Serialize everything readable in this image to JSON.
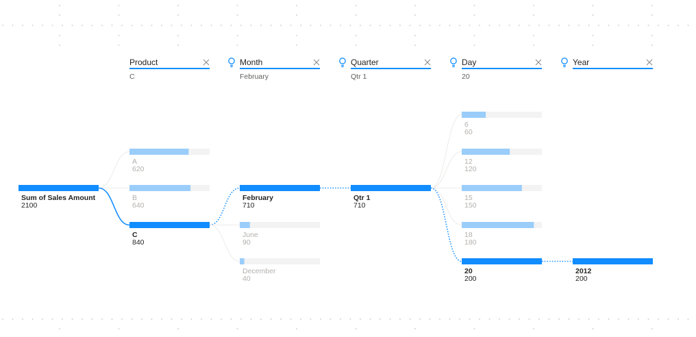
{
  "colors": {
    "accent": "#118DFF",
    "bar_light": "#9ACDFA",
    "bar_track": "#F3F3F3",
    "text_dark": "#252423",
    "text_muted": "#605E5C",
    "text_faded": "#B3B0AD",
    "connector_faded": "#EDEBE9",
    "close_icon": "#8A8886",
    "grid_dot": "#C8C6C4"
  },
  "headers": [
    {
      "field": "Product",
      "selected": "C",
      "icon": null,
      "close_icon": "close-icon"
    },
    {
      "field": "Month",
      "selected": "February",
      "icon": "lightbulb-icon",
      "close_icon": "close-icon"
    },
    {
      "field": "Quarter",
      "selected": "Qtr 1",
      "icon": "lightbulb-icon",
      "close_icon": "close-icon"
    },
    {
      "field": "Day",
      "selected": "20",
      "icon": "lightbulb-icon",
      "close_icon": "close-icon"
    },
    {
      "field": "Year",
      "selected": "",
      "icon": "lightbulb-icon",
      "close_icon": "close-icon"
    }
  ],
  "chart_data": {
    "type": "decomposition-tree",
    "root": {
      "label": "Sum of Sales Amount",
      "value": 2100
    },
    "levels": [
      {
        "field": "Product",
        "parent": "root",
        "nodes": [
          {
            "label": "A",
            "value": 620,
            "selected": false
          },
          {
            "label": "B",
            "value": 640,
            "selected": false
          },
          {
            "label": "C",
            "value": 840,
            "selected": true
          }
        ]
      },
      {
        "field": "Month",
        "parent": "C",
        "nodes": [
          {
            "label": "February",
            "value": 710,
            "selected": true
          },
          {
            "label": "June",
            "value": 90,
            "selected": false
          },
          {
            "label": "December",
            "value": 40,
            "selected": false
          }
        ]
      },
      {
        "field": "Quarter",
        "parent": "February",
        "nodes": [
          {
            "label": "Qtr 1",
            "value": 710,
            "selected": true
          }
        ]
      },
      {
        "field": "Day",
        "parent": "Qtr 1",
        "nodes": [
          {
            "label": "6",
            "value": 60,
            "selected": false
          },
          {
            "label": "12",
            "value": 120,
            "selected": false
          },
          {
            "label": "15",
            "value": 150,
            "selected": false
          },
          {
            "label": "18",
            "value": 180,
            "selected": false
          },
          {
            "label": "20",
            "value": 200,
            "selected": true
          }
        ]
      },
      {
        "field": "Year",
        "parent": "20",
        "nodes": [
          {
            "label": "2012",
            "value": 200,
            "selected": true
          }
        ]
      }
    ]
  }
}
